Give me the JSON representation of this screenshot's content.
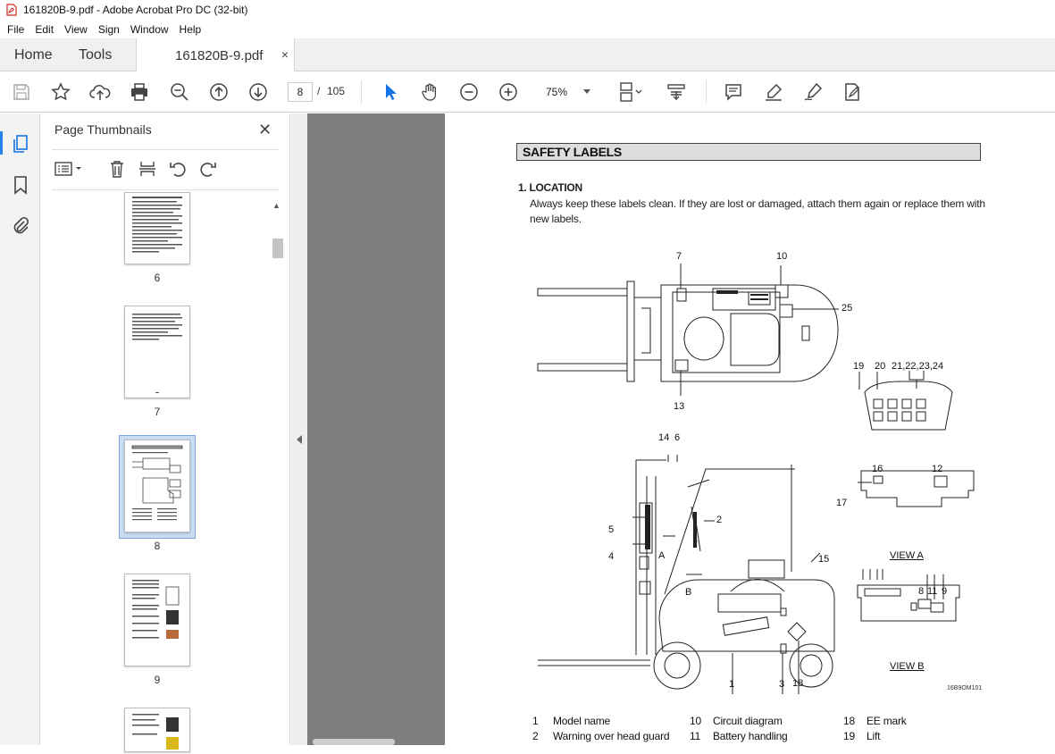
{
  "window": {
    "title": "161820B-9.pdf - Adobe Acrobat Pro DC (32-bit)"
  },
  "menu": [
    "File",
    "Edit",
    "View",
    "Sign",
    "Window",
    "Help"
  ],
  "tabs": {
    "home": "Home",
    "tools": "Tools",
    "doc": "161820B-9.pdf",
    "close": "×"
  },
  "toolbar": {
    "page_current": "8",
    "page_sep": "/",
    "page_total": "105",
    "zoom": "75%"
  },
  "thumbnails": {
    "title": "Page Thumbnails",
    "close": "✕",
    "pages": [
      "6",
      "7",
      "8",
      "9"
    ],
    "selected": "8"
  },
  "document": {
    "section_title": "SAFETY LABELS",
    "location_heading": "1. LOCATION",
    "location_text": "Always keep these labels clean.  If they are lost or damaged, attach them again or replace them with new labels.",
    "callouts": {
      "c7": "7",
      "c10": "10",
      "c25": "25",
      "c13": "13",
      "c19": "19",
      "c20": "20",
      "c2124": "21,22,23,24",
      "c14": "14",
      "c6": "6",
      "c2": "2",
      "c5": "5",
      "c4": "4",
      "cA": "A",
      "cB": "B",
      "c15": "15",
      "c1": "1",
      "c3": "3",
      "c18": "18",
      "c16": "16",
      "c12": "12",
      "c17": "17",
      "c8": "8",
      "c11": "11",
      "c9": "9"
    },
    "view_a": "VIEW A",
    "view_b": "VIEW B",
    "figure_code": "16B9OM101",
    "label_list": [
      {
        "num": "1",
        "name": "Model name"
      },
      {
        "num": "2",
        "name": "Warning over head guard"
      },
      {
        "num": "10",
        "name": "Circuit diagram"
      },
      {
        "num": "11",
        "name": "Battery handling"
      },
      {
        "num": "18",
        "name": "EE mark"
      },
      {
        "num": "19",
        "name": "Lift"
      }
    ]
  }
}
